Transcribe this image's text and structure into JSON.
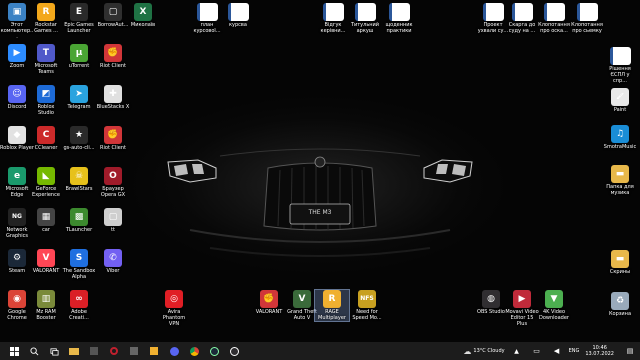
{
  "colors": {
    "word_blue": "#2b579a",
    "taskbar": "#1c1c1c",
    "accent": "#0078d4"
  },
  "wallpaper": {
    "plate_text": "THE M3"
  },
  "icons": {
    "col1": [
      {
        "label": "Этот компьютер...",
        "icon": "pc-icon",
        "color": "#3b82c4",
        "glyph": "▣"
      },
      {
        "label": "Zoom",
        "icon": "zoom-icon",
        "color": "#2d8cff",
        "glyph": "▶"
      },
      {
        "label": "Discord",
        "icon": "discord-icon",
        "color": "#5865f2",
        "glyph": "☺"
      },
      {
        "label": "Roblox Player",
        "icon": "roblox-icon",
        "color": "#e2e2e2",
        "glyph": "◆"
      },
      {
        "label": "Microsoft Edge",
        "icon": "edge-icon",
        "color": "#1a9a6c",
        "glyph": "e"
      },
      {
        "label": "Network Graphics",
        "icon": "network-graphics-icon",
        "color": "#222",
        "glyph": "NG"
      },
      {
        "label": "Steam",
        "icon": "steam-icon",
        "color": "#1b2838",
        "glyph": "⚙"
      },
      {
        "label": "Google Chrome",
        "icon": "chrome-icon",
        "color": "#db4437",
        "glyph": "◉"
      }
    ],
    "col2": [
      {
        "label": "Rockstar Games ...",
        "icon": "rockstar-icon",
        "color": "#f3a81b",
        "glyph": "R"
      },
      {
        "label": "Microsoft Teams",
        "icon": "teams-icon",
        "color": "#5059c9",
        "glyph": "T"
      },
      {
        "label": "Roblox Studio",
        "icon": "roblox-studio-icon",
        "color": "#1d6ad6",
        "glyph": "◩"
      },
      {
        "label": "CCleaner",
        "icon": "ccleaner-icon",
        "color": "#cc2a2a",
        "glyph": "C"
      },
      {
        "label": "GeForce Experience",
        "icon": "geforce-icon",
        "color": "#76b900",
        "glyph": "◣"
      },
      {
        "label": "car",
        "icon": "car-image-icon",
        "color": "#444",
        "glyph": "▦"
      },
      {
        "label": "VALORANT",
        "icon": "valorant-icon",
        "color": "#ff4655",
        "glyph": "V"
      },
      {
        "label": "Mz RAM Booster",
        "icon": "ram-booster-icon",
        "color": "#7a8a3a",
        "glyph": "▥"
      }
    ],
    "col3": [
      {
        "label": "Epic Games Launcher",
        "icon": "epic-icon",
        "color": "#2a2a2a",
        "glyph": "E"
      },
      {
        "label": "uTorrent",
        "icon": "utorrent-icon",
        "color": "#4aa534",
        "glyph": "μ"
      },
      {
        "label": "Telegram",
        "icon": "telegram-icon",
        "color": "#2aa3df",
        "glyph": "➤"
      },
      {
        "label": "gs-auto-cli...",
        "icon": "gs-auto-icon",
        "color": "#2a2a2a",
        "glyph": "★"
      },
      {
        "label": "BrawlStars",
        "icon": "brawlstars-icon",
        "color": "#e7c11b",
        "glyph": "☠"
      },
      {
        "label": "TLauncher",
        "icon": "tlauncher-icon",
        "color": "#3c8a2e",
        "glyph": "▩"
      },
      {
        "label": "The Sandbox Alpha",
        "icon": "sandbox-icon",
        "color": "#1f6fe0",
        "glyph": "S"
      },
      {
        "label": "Adobe Creati...",
        "icon": "adobe-cc-icon",
        "color": "#da1f26",
        "glyph": "∞"
      }
    ],
    "col4": [
      {
        "label": "BorrowAut...",
        "icon": "borrow-icon",
        "color": "#2f2f2f",
        "glyph": "▢"
      },
      {
        "label": "Riot Client",
        "icon": "riot-icon-1",
        "color": "#d13639",
        "glyph": "✊"
      },
      {
        "label": "BlueStacks X",
        "icon": "bluestacks-icon",
        "color": "#e0e0e0",
        "glyph": "✚"
      },
      {
        "label": "Riot Client",
        "icon": "riot-icon-2",
        "color": "#d13639",
        "glyph": "✊"
      },
      {
        "label": "Браузер Opera GX",
        "icon": "opera-gx-icon",
        "color": "#a01b2a",
        "glyph": "O"
      },
      {
        "label": "tt",
        "icon": "tt-icon",
        "color": "#cfcfcf",
        "glyph": "▢"
      },
      {
        "label": "Viber",
        "icon": "viber-icon",
        "color": "#7360f2",
        "glyph": "✆"
      }
    ],
    "col5": [
      {
        "label": "Миколаїв",
        "icon": "excel-icon",
        "color": "#1f7244",
        "glyph": "X"
      }
    ],
    "docs_top": [
      {
        "label": "план курсової...",
        "icon": "word-doc-icon"
      },
      {
        "label": "курсва",
        "icon": "word-doc-icon"
      },
      {
        "label": "Відгук керівни...",
        "icon": "word-doc-icon"
      },
      {
        "label": "Титульний аркуш",
        "icon": "word-doc-icon"
      },
      {
        "label": "щоденник практики",
        "icon": "word-doc-icon"
      },
      {
        "label": "Проект ухвали су...",
        "icon": "word-doc-icon"
      },
      {
        "label": "Скарга до суду на ...",
        "icon": "word-doc-icon"
      },
      {
        "label": "Клопотання про оска...",
        "icon": "word-doc-icon"
      },
      {
        "label": "Клопотання про сьемку",
        "icon": "word-doc-icon"
      }
    ],
    "right_col": [
      {
        "label": "Рішення ЄСПЛ у спр...",
        "icon": "word-doc-icon",
        "color": "#2b579a",
        "glyph": "W"
      },
      {
        "label": "Paint",
        "icon": "paint-icon",
        "color": "#e8e8e8",
        "glyph": "🖌"
      },
      {
        "label": "SmotraMusic",
        "icon": "smotra-icon",
        "color": "#1a8dd6",
        "glyph": "♫"
      },
      {
        "label": "Папка для музика",
        "icon": "folder-icon",
        "color": "#e8b84a",
        "glyph": "▬"
      },
      {
        "label": "Скрины",
        "icon": "folder-icon",
        "color": "#e8b84a",
        "glyph": "▬"
      },
      {
        "label": "Корзина",
        "icon": "recycle-bin-icon",
        "color": "#9ab",
        "glyph": "♻"
      }
    ],
    "bottom_row": [
      {
        "label": "Avira Phantom VPN",
        "icon": "avira-icon",
        "color": "#e01e25",
        "glyph": "◎"
      },
      {
        "label": "VALORANT",
        "icon": "riot-icon-3",
        "color": "#d13639",
        "glyph": "✊"
      },
      {
        "label": "Grand Theft Auto V",
        "icon": "gta-icon",
        "color": "#3a6a3a",
        "glyph": "V"
      },
      {
        "label": "RAGE Multiplayer",
        "icon": "rage-mp-icon",
        "color": "#f0b030",
        "glyph": "R"
      },
      {
        "label": "Need for Speed Mo...",
        "icon": "nfs-icon",
        "color": "#c8a020",
        "glyph": "NFS"
      },
      {
        "label": "OBS Studio",
        "icon": "obs-icon",
        "color": "#302e31",
        "glyph": "◍"
      },
      {
        "label": "Movavi Video Editor 15 Plus",
        "icon": "movavi-icon",
        "color": "#c02a3a",
        "glyph": "▶"
      },
      {
        "label": "4K Video Downloader",
        "icon": "4k-video-icon",
        "color": "#4caf50",
        "glyph": "▼"
      }
    ]
  },
  "taskbar": {
    "weather": "13°C Cloudy",
    "lang": "ENG",
    "time": "10:46",
    "date": "13.07.2022"
  }
}
